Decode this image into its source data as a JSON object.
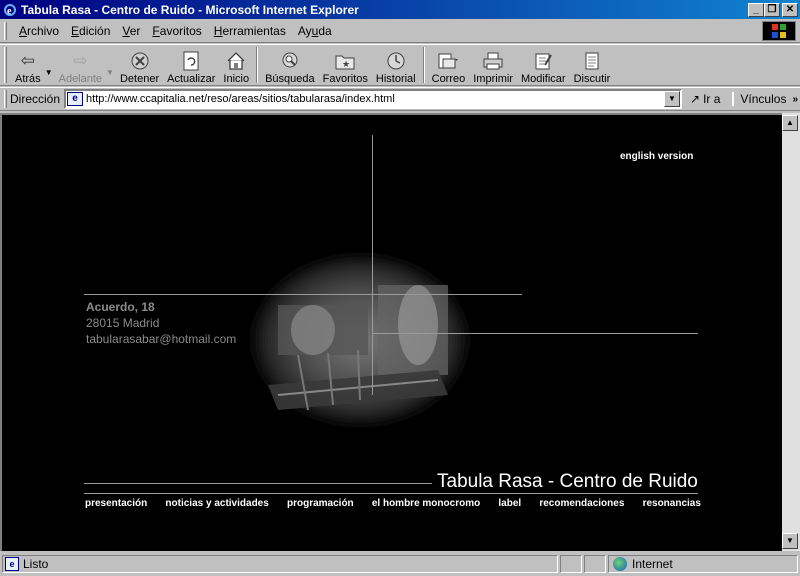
{
  "window": {
    "title": "Tabula Rasa - Centro de Ruido - Microsoft Internet Explorer",
    "controls": [
      "_",
      "❐",
      "✕"
    ]
  },
  "menu": [
    {
      "pre": "",
      "key": "A",
      "post": "rchivo"
    },
    {
      "pre": "",
      "key": "E",
      "post": "dición"
    },
    {
      "pre": "",
      "key": "V",
      "post": "er"
    },
    {
      "pre": "",
      "key": "F",
      "post": "avoritos"
    },
    {
      "pre": "",
      "key": "H",
      "post": "erramientas"
    },
    {
      "pre": "Ay",
      "key": "u",
      "post": "da"
    }
  ],
  "toolbar": {
    "back": "Atrás",
    "forward": "Adelante",
    "stop": "Detener",
    "refresh": "Actualizar",
    "home": "Inicio",
    "search": "Búsqueda",
    "favorites": "Favoritos",
    "history": "Historial",
    "mail": "Correo",
    "print": "Imprimir",
    "edit": "Modificar",
    "discuss": "Discutir"
  },
  "address": {
    "label": "Dirección",
    "url": "http://www.ccapitalia.net/reso/areas/sitios/tabularasa/index.html",
    "go": "Ir a",
    "links": "Vínculos"
  },
  "page": {
    "english": "english version",
    "street": "Acuerdo, 18",
    "city": "28015 Madrid",
    "email": "tabularasabar@hotmail.com",
    "site_title": "Tabula Rasa - Centro de Ruido",
    "nav": [
      "presentación",
      "noticias y actividades",
      "programación",
      "el hombre monocromo",
      "label",
      "recomendaciones",
      "resonancias"
    ]
  },
  "status": {
    "text": "Listo",
    "zone": "Internet"
  }
}
